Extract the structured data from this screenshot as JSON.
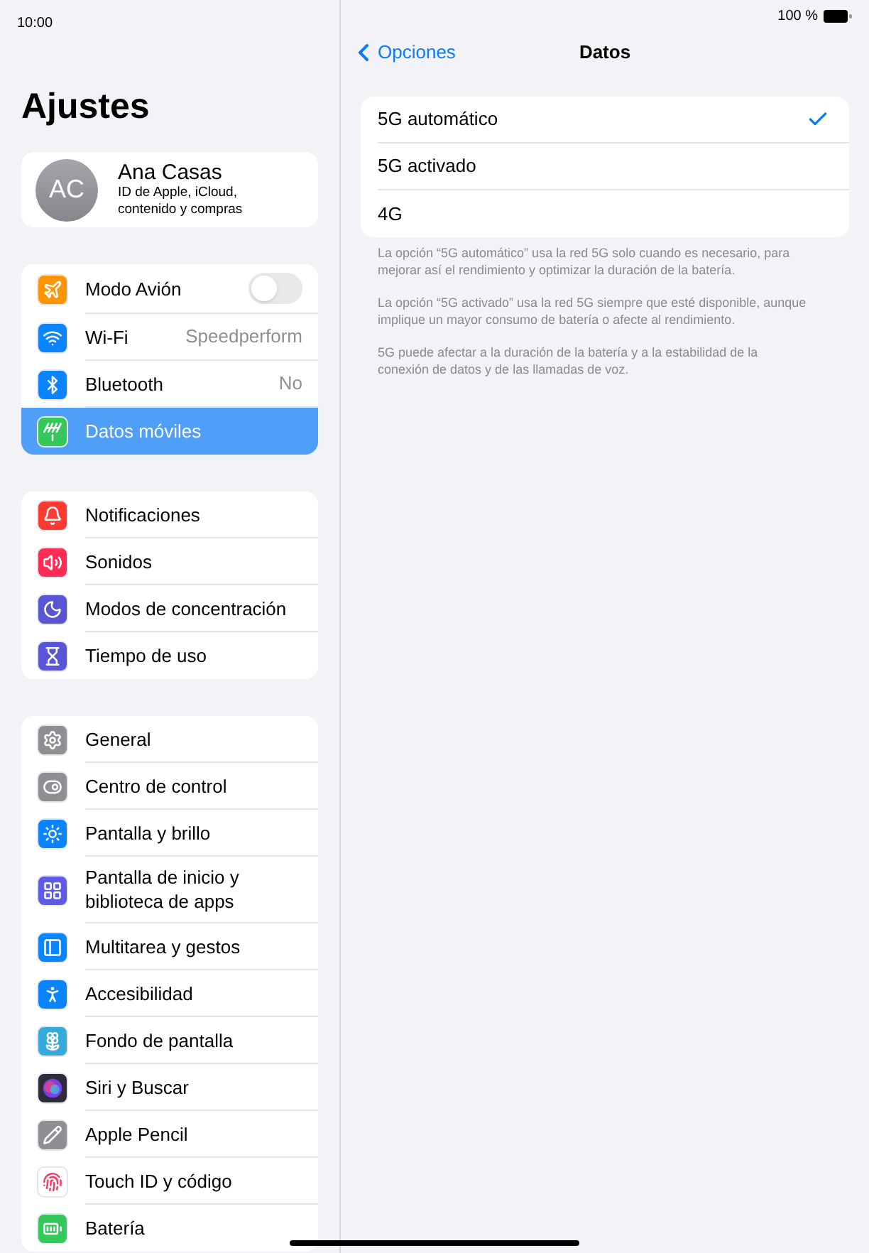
{
  "status_bar": {
    "time": "10:00",
    "battery": "100 %"
  },
  "sidebar": {
    "title": "Ajustes",
    "profile": {
      "initials": "AC",
      "name": "Ana Casas",
      "subtitle": "ID de Apple, iCloud, contenido y compras"
    },
    "groups": [
      {
        "items": [
          {
            "label": "Modo Avión",
            "kind": "toggle",
            "on": false,
            "color": "#ff9500",
            "selected": false
          },
          {
            "label": "Wi-Fi",
            "kind": "value",
            "value": "Speedperform",
            "color": "#0a84ff",
            "selected": false
          },
          {
            "label": "Bluetooth",
            "kind": "value",
            "value": "No",
            "color": "#0a84ff",
            "selected": false
          },
          {
            "label": "Datos móviles",
            "kind": "link",
            "color": "#34c759",
            "selected": true
          }
        ]
      },
      {
        "items": [
          {
            "label": "Notificaciones",
            "kind": "link",
            "color": "#ff3b30",
            "selected": false
          },
          {
            "label": "Sonidos",
            "kind": "link",
            "color": "#ff2d55",
            "selected": false
          },
          {
            "label": "Modos de concentración",
            "kind": "link",
            "color": "#5856d6",
            "selected": false
          },
          {
            "label": "Tiempo de uso",
            "kind": "link",
            "color": "#5856d6",
            "selected": false
          }
        ]
      },
      {
        "items": [
          {
            "label": "General",
            "kind": "link",
            "color": "#8e8e93",
            "selected": false
          },
          {
            "label": "Centro de control",
            "kind": "link",
            "color": "#8e8e93",
            "selected": false
          },
          {
            "label": "Pantalla y brillo",
            "kind": "link",
            "color": "#0a84ff",
            "selected": false
          },
          {
            "label": "Pantalla de inicio y biblioteca de apps",
            "kind": "link",
            "color": "#5e5ce6",
            "selected": false
          },
          {
            "label": "Multitarea y gestos",
            "kind": "link",
            "color": "#0a84ff",
            "selected": false
          },
          {
            "label": "Accesibilidad",
            "kind": "link",
            "color": "#0a84ff",
            "selected": false
          },
          {
            "label": "Fondo de pantalla",
            "kind": "link",
            "color": "#35aadc",
            "selected": false
          },
          {
            "label": "Siri y Buscar",
            "kind": "link",
            "color": "#2c2c3a",
            "selected": false
          },
          {
            "label": "Apple Pencil",
            "kind": "link",
            "color": "#8e8e93",
            "selected": false
          },
          {
            "label": "Touch ID y código",
            "kind": "link",
            "color": "#ffffff",
            "selected": false
          },
          {
            "label": "Batería",
            "kind": "link",
            "color": "#34c759",
            "selected": false
          }
        ]
      }
    ]
  },
  "detail": {
    "back": "Opciones",
    "title": "Datos",
    "options": [
      {
        "label": "5G automático",
        "selected": true
      },
      {
        "label": "5G activado",
        "selected": false
      },
      {
        "label": "4G",
        "selected": false
      }
    ],
    "notes": [
      "La opción “5G automático” usa la red 5G solo cuando es necesario, para mejorar así el rendimiento y optimizar la duración de la batería.",
      "La opción “5G activado” usa la red 5G siempre que esté disponible, aunque implique un mayor consumo de batería o afecte al rendimiento.",
      "5G puede afectar a la duración de la batería y a la estabilidad de la conexión de datos y de las llamadas de voz."
    ]
  }
}
